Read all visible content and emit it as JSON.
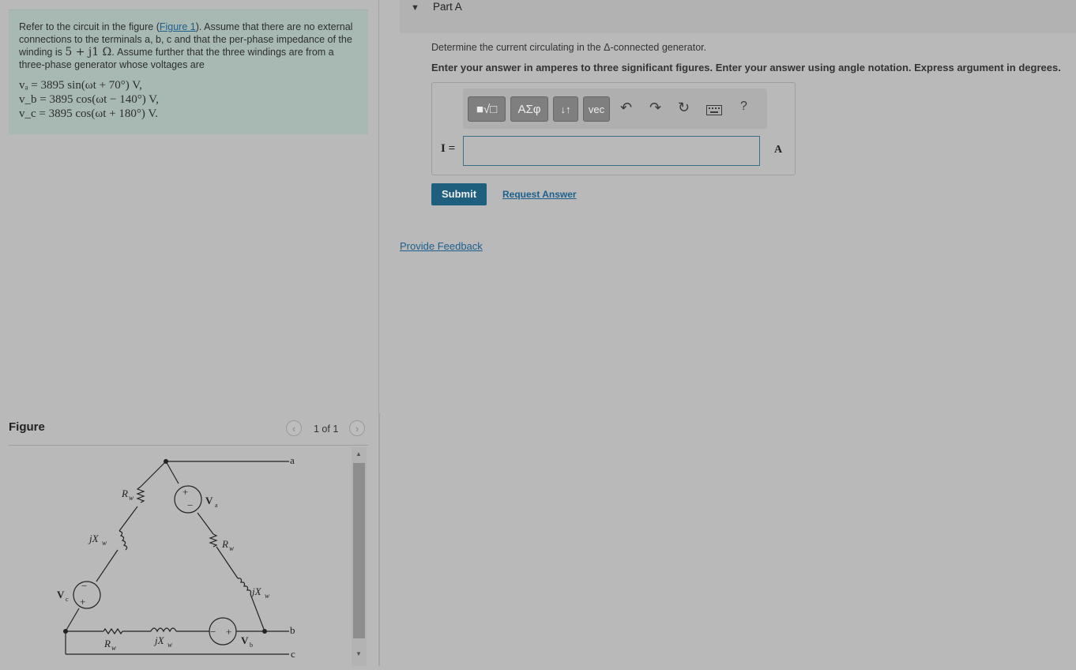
{
  "problem": {
    "text_before_link": "Refer to the circuit in the figure (",
    "link": "Figure 1",
    "text_after_link": "). Assume that there are no external connections to the terminals a, b, c and that the per-phase impedance of the winding is ",
    "impedance": "5 + j1 Ω",
    "text_end": ". Assume further that the three windings are from a three-phase generator whose voltages are",
    "eq_a": "vₐ = 3895 sin(ωt + 70°) V,",
    "eq_b": "v_b = 3895 cos(ωt − 140°) V,",
    "eq_c": "v_c = 3895 cos(ωt + 180°) V."
  },
  "figure": {
    "title": "Figure",
    "pager": "1 of 1",
    "prev_icon": "chevron-left-icon",
    "next_icon": "chevron-right-icon",
    "labels": {
      "a": "a",
      "b": "b",
      "c": "c",
      "Va": "V",
      "Va_sub": "a",
      "Vb": "V",
      "Vb_sub": "b",
      "Vc": "V",
      "Vc_sub": "c",
      "Rw": "R",
      "Rw_sub": "w",
      "jXw": "jX",
      "jXw_sub": "w"
    }
  },
  "part": {
    "title": "Part A",
    "question": "Determine the current circulating in the Δ-connected generator.",
    "instruction": "Enter your answer in amperes to three significant figures. Enter your answer using angle notation. Express argument in degrees."
  },
  "toolbar": {
    "templates": "■√□",
    "greek": "ΑΣφ",
    "arrows": "↓↑",
    "vec": "vec",
    "undo_icon": "undo-icon",
    "redo_icon": "redo-icon",
    "reset_icon": "reset-icon",
    "keyboard_icon": "keyboard-icon",
    "help": "?"
  },
  "answer": {
    "label": "I =",
    "value": "",
    "unit": "A"
  },
  "buttons": {
    "submit": "Submit",
    "request": "Request Answer",
    "feedback": "Provide Feedback"
  }
}
